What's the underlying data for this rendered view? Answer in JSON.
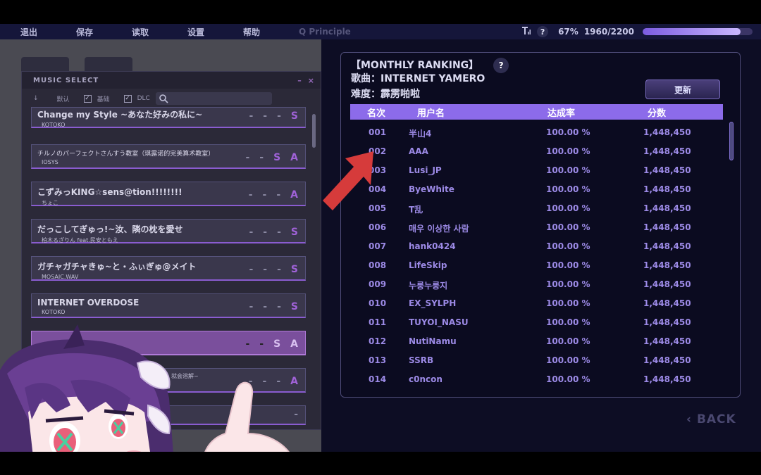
{
  "menu": {
    "exit": "退出",
    "save": "保存",
    "load": "读取",
    "settings": "设置",
    "help": "帮助",
    "principle": "Q Principle"
  },
  "status": {
    "help_symbol": "?",
    "percent": "67%",
    "progress_text": "1960/2200",
    "progress_fraction": 0.891
  },
  "music_select": {
    "title": "MUSIC SELECT",
    "minimize": "–",
    "close": "×",
    "sort_arrow": "↓",
    "filter_default": "默认",
    "filter_basic": "基础",
    "filter_dlc": "DLC",
    "songs": [
      {
        "title": "Change my Style ~あなた好みの私に~",
        "artist": "KOTOKO",
        "marks": [
          "-",
          "-",
          "-",
          "S"
        ]
      },
      {
        "title": "チルノのパーフェクトさんすう教室（琪露诺的完美算术教室）",
        "artist": "IOSYS",
        "marks": [
          "-",
          "-",
          "S",
          "A"
        ]
      },
      {
        "title": "こずみっKING☆sens@tion!!!!!!!!",
        "artist": "ちょこ",
        "marks": [
          "-",
          "-",
          "-",
          "A"
        ]
      },
      {
        "title": "だっこしてぎゅっ!~汝、隣の枕を愛せ",
        "artist": "柏木るざりん feat.民安ともえ",
        "marks": [
          "-",
          "-",
          "-",
          "S"
        ]
      },
      {
        "title": "ガチャガチャきゅ~と・ふぃぎゅ@メイト",
        "artist": "MOSAIC.WAV",
        "marks": [
          "-",
          "-",
          "-",
          "S"
        ]
      },
      {
        "title": "INTERNET OVERDOSE",
        "artist": "KOTOKO",
        "marks": [
          "-",
          "-",
          "-",
          "S"
        ]
      },
      {
        "title": "",
        "artist": "",
        "marks": [
          "-",
          "-",
          "S",
          "A"
        ]
      },
      {
        "title": "",
        "artist": "就会溶解~",
        "marks": [
          "-",
          "-",
          "-",
          "A"
        ]
      },
      {
        "title": "",
        "artist": "",
        "marks": [
          "-"
        ]
      }
    ]
  },
  "ranking": {
    "title": "【MONTHLY RANKING】",
    "help_symbol": "?",
    "song_line": "歌曲：INTERNET YAMERO",
    "difficulty_line": "难度：霹雳啪啦",
    "refresh": "更新",
    "headers": {
      "rank": "名次",
      "user": "用户名",
      "rate": "达成率",
      "score": "分数"
    },
    "rows": [
      {
        "rank": "001",
        "user": "半山4",
        "rate": "100.00 %",
        "score": "1,448,450"
      },
      {
        "rank": "002",
        "user": "AAA",
        "rate": "100.00 %",
        "score": "1,448,450"
      },
      {
        "rank": "003",
        "user": "Lusi_JP",
        "rate": "100.00 %",
        "score": "1,448,450"
      },
      {
        "rank": "004",
        "user": "ByeWhite",
        "rate": "100.00 %",
        "score": "1,448,450"
      },
      {
        "rank": "005",
        "user": "T乱",
        "rate": "100.00 %",
        "score": "1,448,450"
      },
      {
        "rank": "006",
        "user": "매우 이상한 사람",
        "rate": "100.00 %",
        "score": "1,448,450"
      },
      {
        "rank": "007",
        "user": "hank0424",
        "rate": "100.00 %",
        "score": "1,448,450"
      },
      {
        "rank": "008",
        "user": "LifeSkip",
        "rate": "100.00 %",
        "score": "1,448,450"
      },
      {
        "rank": "009",
        "user": "누룽누룽지",
        "rate": "100.00 %",
        "score": "1,448,450"
      },
      {
        "rank": "010",
        "user": "EX_SYLPH",
        "rate": "100.00 %",
        "score": "1,448,450"
      },
      {
        "rank": "011",
        "user": "TUYOI_NASU",
        "rate": "100.00 %",
        "score": "1,448,450"
      },
      {
        "rank": "012",
        "user": "NutiNamu",
        "rate": "100.00 %",
        "score": "1,448,450"
      },
      {
        "rank": "013",
        "user": "SSRB",
        "rate": "100.00 %",
        "score": "1,448,450"
      },
      {
        "rank": "014",
        "user": "c0ncon",
        "rate": "100.00 %",
        "score": "1,448,450"
      }
    ],
    "back": "BACK",
    "back_symbol": "‹"
  },
  "colors": {
    "accent": "#8c6bea",
    "row_text": "#9c8ae6",
    "arrow": "#d63b3b"
  }
}
